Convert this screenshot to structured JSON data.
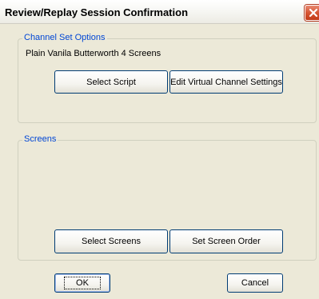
{
  "window": {
    "title": "Review/Replay Session Confirmation"
  },
  "channel_set": {
    "label": "Channel Set Options",
    "name": "Plain Vanila Butterworth 4 Screens",
    "select_script_label": "Select Script",
    "edit_virtual_label": "Edit Virtual Channel Settings"
  },
  "screens": {
    "label": "Screens",
    "select_screens_label": "Select Screens",
    "set_order_label": "Set Screen Order"
  },
  "footer": {
    "ok_label": "OK",
    "cancel_label": "Cancel"
  },
  "colors": {
    "group_label": "#0046d5",
    "close_button": "#d65533",
    "dialog_face": "#ece9d8"
  }
}
